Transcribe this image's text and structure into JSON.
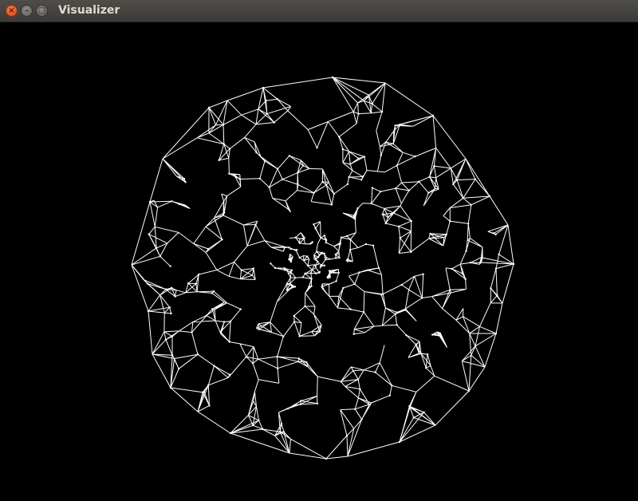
{
  "window": {
    "title": "Visualizer",
    "buttons": {
      "close": "×",
      "minimize": "–",
      "maximize": "□"
    }
  },
  "canvas": {
    "background": "#000000",
    "mesh_color": "#ffffff",
    "content": "white triangulated wireframe mesh of a sphere"
  }
}
